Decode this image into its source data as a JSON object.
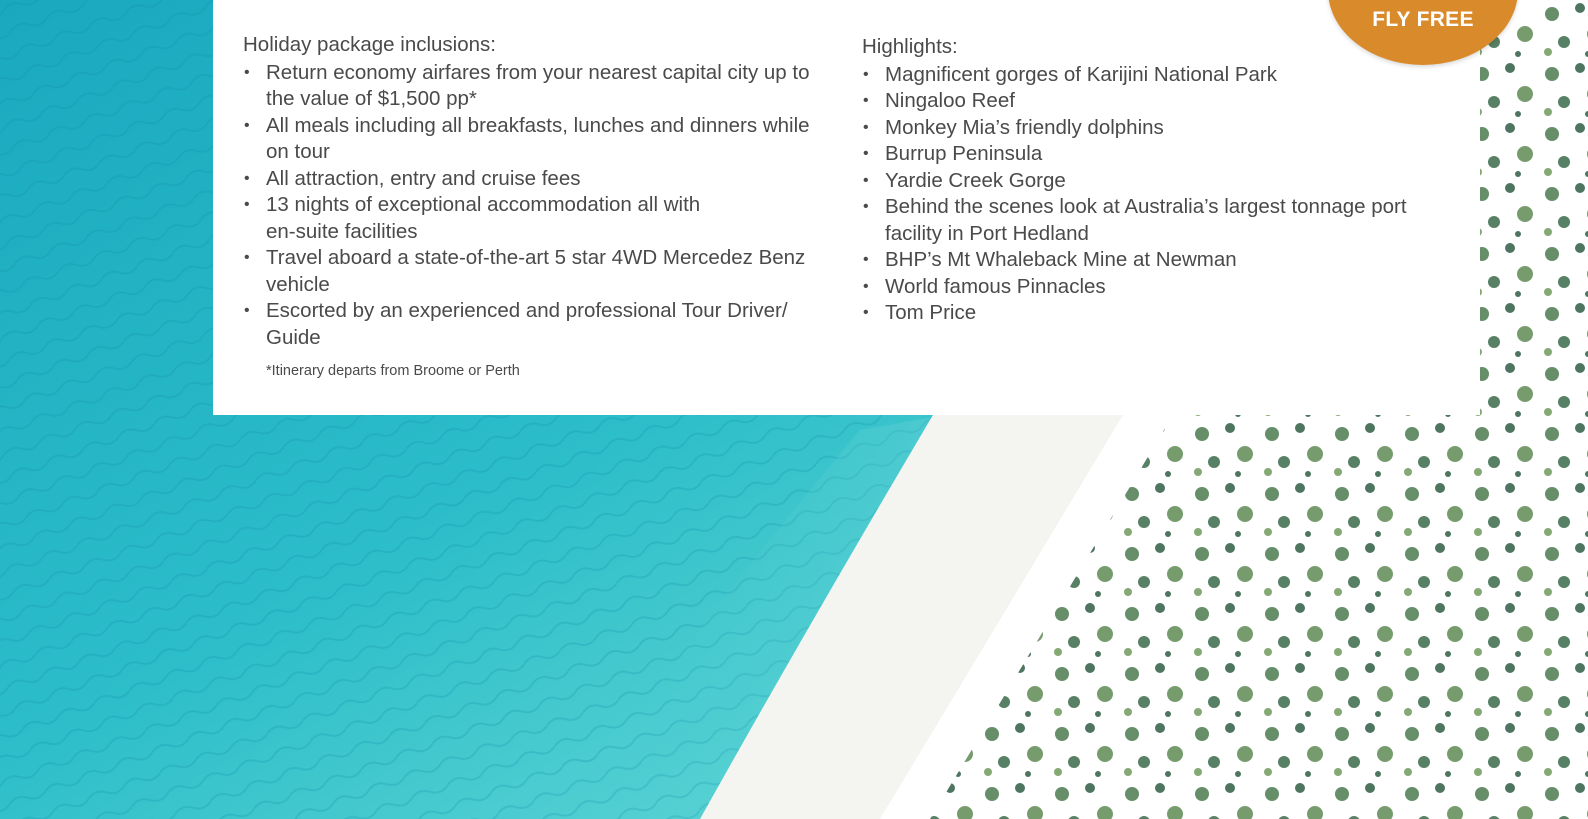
{
  "badge": {
    "label": "FLY FREE",
    "color": "#d98a2b"
  },
  "inclusions": {
    "heading": "Holiday package inclusions:",
    "items": [
      "Return economy airfares from your nearest capital city up to the value of $1,500 pp*",
      "All meals including all breakfasts, lunches and dinners while on tour",
      "All attraction, entry and cruise fees",
      "13 nights of exceptional accommodation all with en-suite facilities",
      "Travel aboard a state-of-the-art 5 star 4WD Mercedez Benz vehicle",
      "Escorted by an experienced and professional Tour Driver/ Guide"
    ],
    "footnote": "*Itinerary departs from Broome or Perth"
  },
  "highlights": {
    "heading": "Highlights:",
    "items": [
      "Magnificent gorges of Karijini National Park",
      "Ningaloo Reef",
      "Monkey Mia’s friendly dolphins",
      "Burrup Peninsula",
      "Yardie Creek Gorge",
      "Behind the scenes look at Australia’s largest tonnage port facility in Port Hedland",
      "BHP’s Mt Whaleback Mine at Newman",
      "World famous Pinnacles",
      "Tom Price"
    ]
  },
  "bullet_glyph": "•",
  "colors": {
    "ocean": "#2bb8c6",
    "sand": "#f3f3ef",
    "vegetation": "#3f6f4a",
    "text": "#4a4a4a"
  }
}
